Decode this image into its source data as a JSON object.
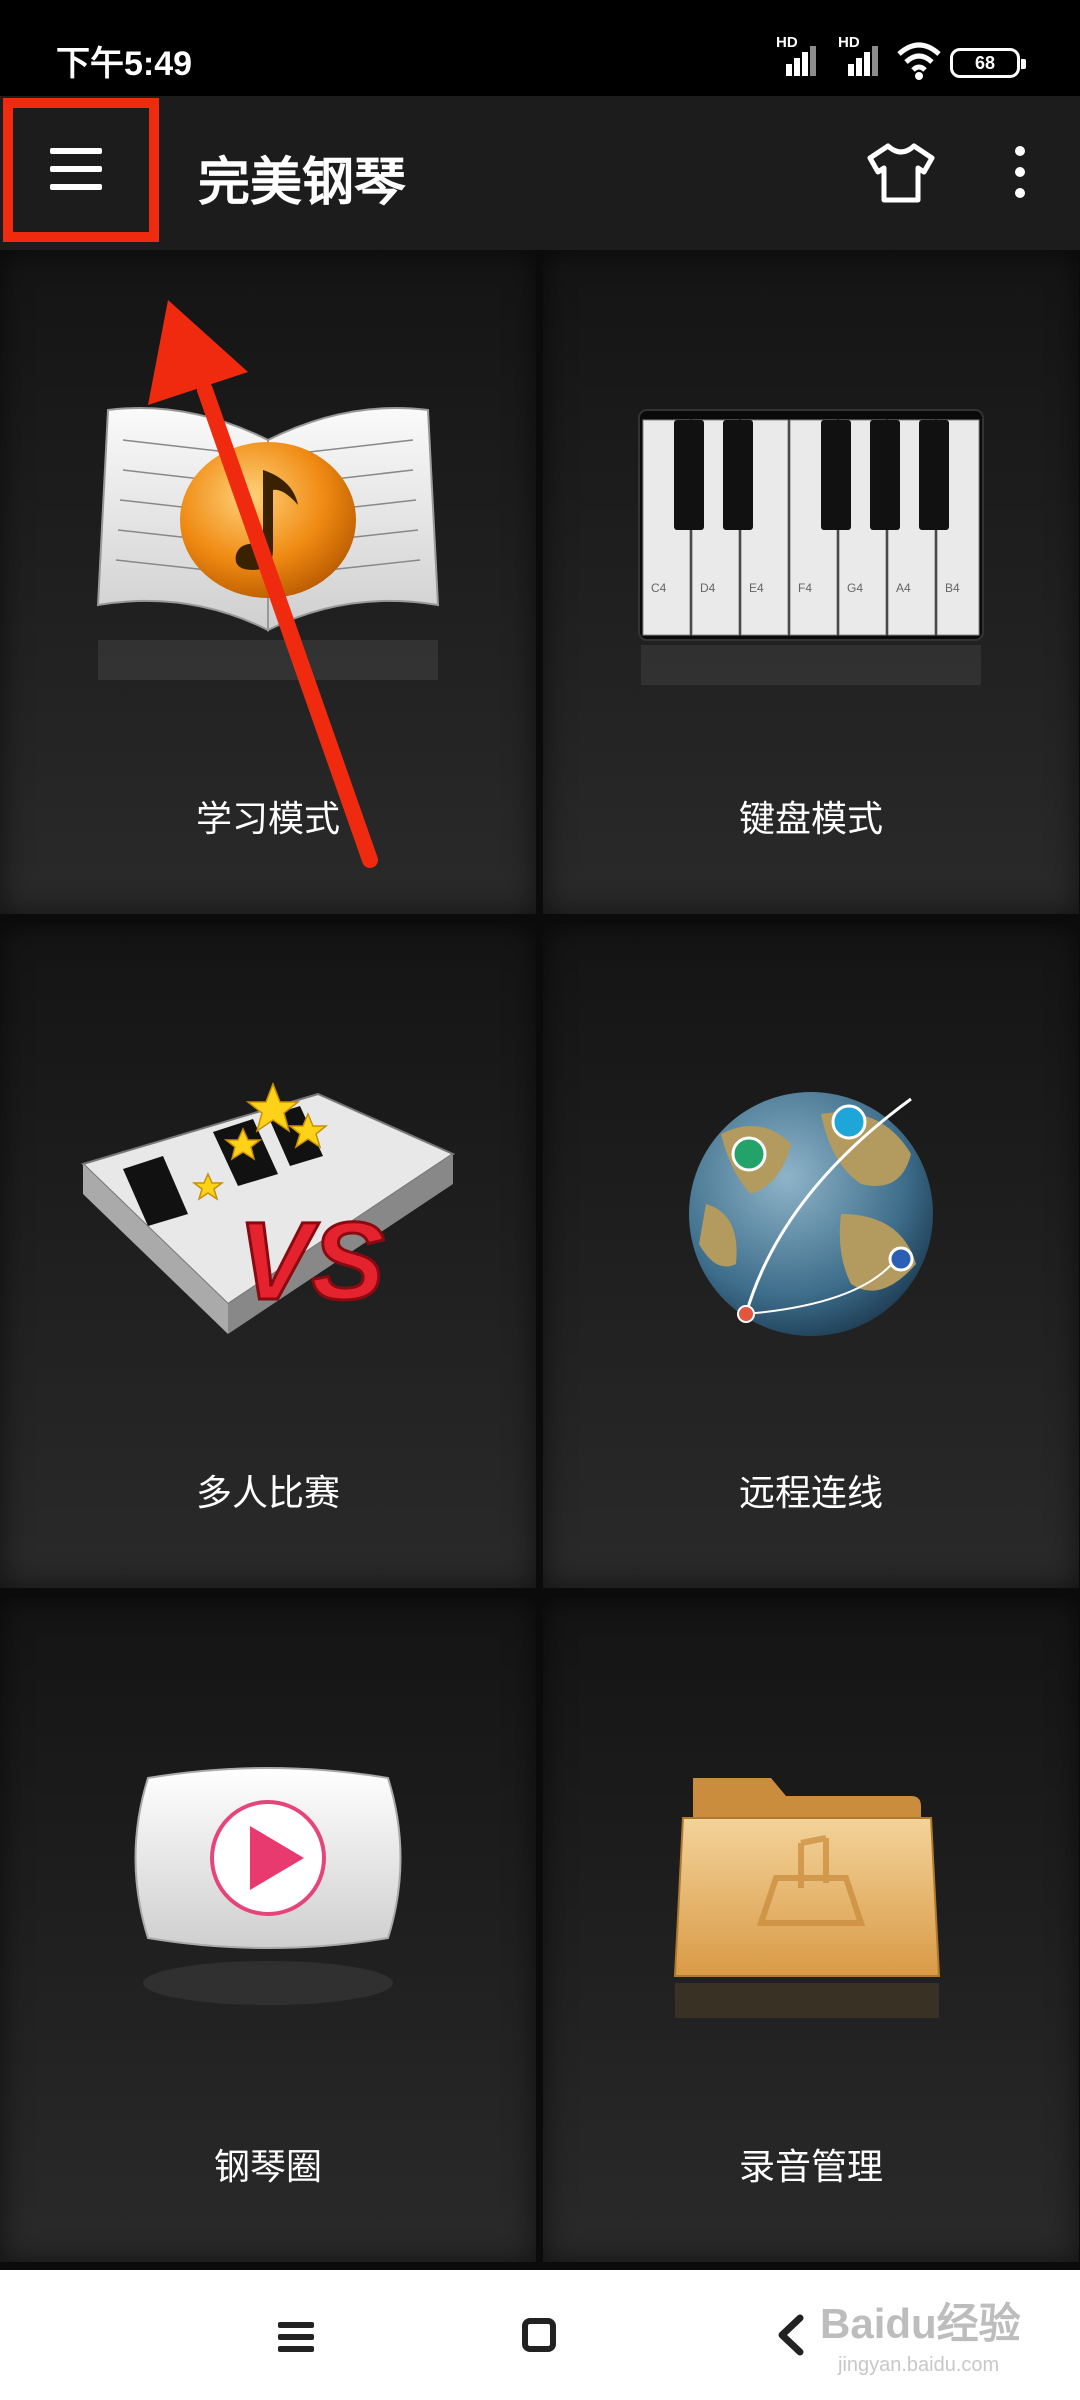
{
  "status_bar": {
    "time": "下午5:49",
    "signal1_label": "HD",
    "signal2_label": "HD",
    "battery": "68"
  },
  "app_bar": {
    "title": "完美钢琴",
    "icons": [
      "menu-icon",
      "tshirt-icon",
      "more-vert-icon"
    ]
  },
  "tiles": [
    {
      "label": "学习模式",
      "icon": "sheet-music-book-icon"
    },
    {
      "label": "键盘模式",
      "icon": "piano-keyboard-icon",
      "key_labels": [
        "C4",
        "D4",
        "E4",
        "F4",
        "G4",
        "A4",
        "B4"
      ]
    },
    {
      "label": "多人比赛",
      "icon": "vs-piano-icon",
      "badge_text": "VS"
    },
    {
      "label": "远程连线",
      "icon": "globe-network-icon"
    },
    {
      "label": "钢琴圈",
      "icon": "play-button-icon"
    },
    {
      "label": "录音管理",
      "icon": "music-folder-icon"
    }
  ],
  "nav_bar": {
    "icons": [
      "recent-apps-icon",
      "home-icon",
      "back-icon"
    ],
    "watermark": "Baidu经验",
    "watermark_sub": "jingyan.baidu.com"
  },
  "colors": {
    "annotation": "#f02a0e",
    "app_bar_bg": "#1c1c1c",
    "status_bar_bg": "#000000",
    "tile_bg": "#1e1e1e"
  }
}
